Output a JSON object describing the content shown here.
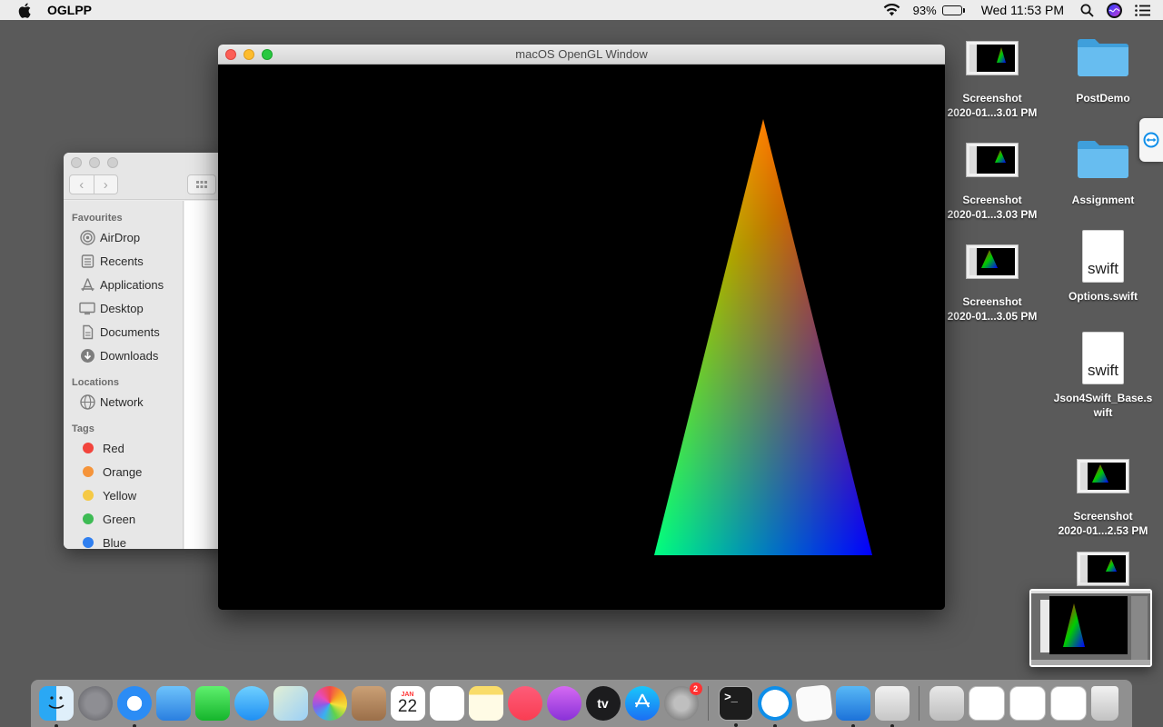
{
  "menubar": {
    "app_name": "OGLPP",
    "battery": "93%",
    "battery_level": 0.93,
    "clock": "Wed 11:53 PM"
  },
  "gl_window": {
    "title": "macOS OpenGL Window"
  },
  "finder": {
    "sections": {
      "favourites": "Favourites",
      "locations": "Locations",
      "tags": "Tags"
    },
    "favourites": [
      {
        "label": "AirDrop",
        "icon": "airdrop-icon"
      },
      {
        "label": "Recents",
        "icon": "recents-icon"
      },
      {
        "label": "Applications",
        "icon": "applications-icon"
      },
      {
        "label": "Desktop",
        "icon": "desktop-icon"
      },
      {
        "label": "Documents",
        "icon": "documents-icon"
      },
      {
        "label": "Downloads",
        "icon": "downloads-icon"
      }
    ],
    "locations": [
      {
        "label": "Network",
        "icon": "network-icon"
      }
    ],
    "tags": [
      {
        "label": "Red",
        "color": "#f2443c"
      },
      {
        "label": "Orange",
        "color": "#f5943a"
      },
      {
        "label": "Yellow",
        "color": "#f5c945"
      },
      {
        "label": "Green",
        "color": "#3dbb54"
      },
      {
        "label": "Blue",
        "color": "#2f7ff0"
      }
    ]
  },
  "desktop_icons": {
    "col1": [
      {
        "line1": "Screenshot",
        "line2": "2020-01...3.01 PM"
      },
      {
        "line1": "Screenshot",
        "line2": "2020-01...3.03 PM"
      },
      {
        "line1": "Screenshot",
        "line2": "2020-01...3.05 PM"
      }
    ],
    "col2": [
      {
        "line1": "PostDemo",
        "line2": ""
      },
      {
        "line1": "Assignment",
        "line2": ""
      },
      {
        "line1": "Options.swift",
        "line2": "",
        "doc_text": "swift"
      },
      {
        "line1": "Json4Swift_Base.s",
        "line2": "wift",
        "doc_text": "swift"
      },
      {
        "line1": "Screenshot",
        "line2": "2020-01...2.53 PM"
      }
    ]
  },
  "dock": {
    "apps": [
      {
        "name": "Finder",
        "icon": "finder-icon",
        "running": true
      },
      {
        "name": "Launchpad",
        "icon": "launchpad-icon",
        "running": false
      },
      {
        "name": "Safari",
        "icon": "safari-icon",
        "running": true
      },
      {
        "name": "Mail",
        "icon": "mail-icon",
        "running": false
      },
      {
        "name": "FaceTime",
        "icon": "facetime-icon",
        "running": false
      },
      {
        "name": "Messages",
        "icon": "messages-icon",
        "running": false
      },
      {
        "name": "Maps",
        "icon": "maps-icon",
        "running": false
      },
      {
        "name": "Photos",
        "icon": "photos-icon",
        "running": false
      },
      {
        "name": "Contacts",
        "icon": "contacts-icon",
        "running": false
      },
      {
        "name": "Calendar",
        "icon": "calendar-icon",
        "running": false,
        "month": "JAN",
        "day": "22"
      },
      {
        "name": "Reminders",
        "icon": "reminders-icon",
        "running": false
      },
      {
        "name": "Notes",
        "icon": "notes-icon",
        "running": false
      },
      {
        "name": "Music",
        "icon": "music-icon",
        "running": false
      },
      {
        "name": "Podcasts",
        "icon": "podcasts-icon",
        "running": false
      },
      {
        "name": "TV",
        "icon": "tv-icon",
        "running": false,
        "label": "tv"
      },
      {
        "name": "App Store",
        "icon": "appstore-icon",
        "running": false
      },
      {
        "name": "System Preferences",
        "icon": "system-preferences-icon",
        "running": false,
        "badge": "2"
      },
      {
        "name": "Terminal",
        "icon": "terminal-icon",
        "running": true,
        "label": ">_"
      },
      {
        "name": "TeamViewer",
        "icon": "teamviewer-icon",
        "running": true
      },
      {
        "name": "TextEdit",
        "icon": "textedit-icon",
        "running": false
      },
      {
        "name": "Xcode",
        "icon": "xcode-icon",
        "running": true
      },
      {
        "name": "Instruments",
        "icon": "instruments-icon",
        "running": true
      }
    ]
  }
}
